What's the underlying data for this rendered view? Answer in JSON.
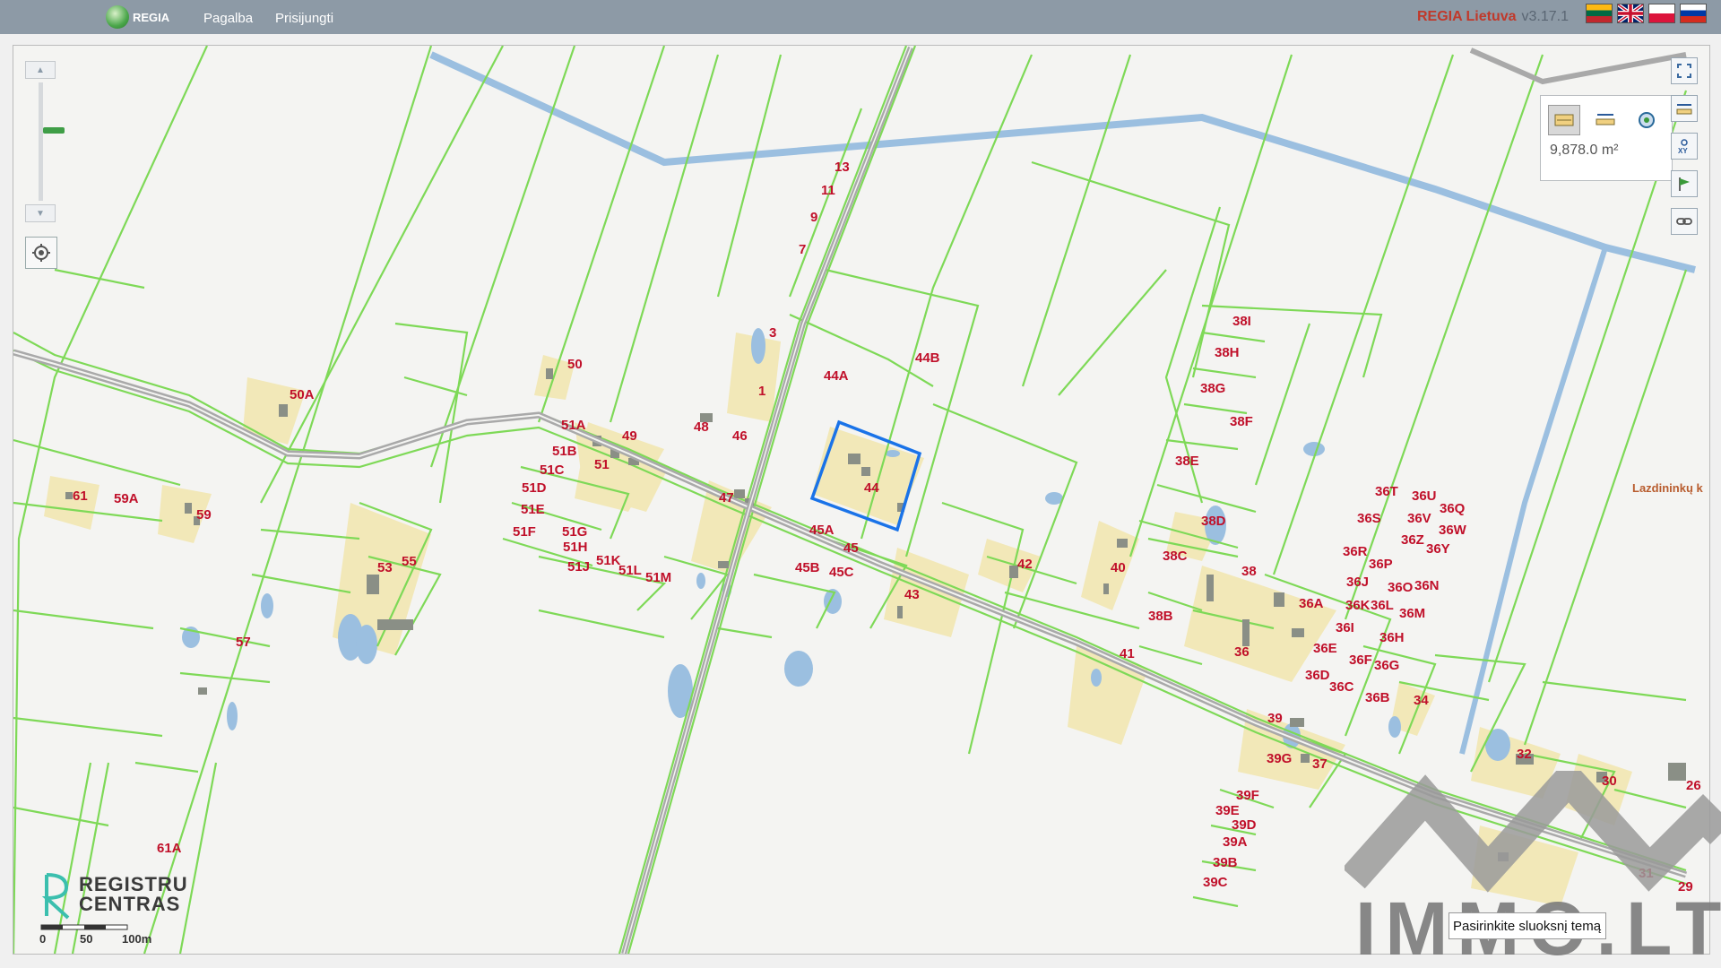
{
  "app": {
    "logo_text": "REGIA"
  },
  "nav": {
    "help": "Pagalba",
    "login": "Prisijungti"
  },
  "brand": {
    "name": "REGIA Lietuva",
    "version": "v3.17.1"
  },
  "languages": [
    "Lithuanian",
    "English",
    "Polish",
    "Russian"
  ],
  "measure": {
    "value": "9,878.0 m²"
  },
  "tools": [
    "fullscreen-icon",
    "measure-distance-icon",
    "xy-coordinates-icon",
    "flag-icon",
    "link-icon"
  ],
  "scale": {
    "labels": [
      "0",
      "50",
      "100m"
    ]
  },
  "logo": {
    "line1": "REGISTRU",
    "line2": "CENTRAS"
  },
  "search": {
    "placeholder": "Pasirinkite sluoksnį temą"
  },
  "street_label": "Lazdininkų k",
  "watermark_text": "IMMO.LT",
  "colors": {
    "parcel": "#7ed957",
    "building_lot": "#f2e8b8",
    "water": "#9bbfe0",
    "road": "#a9a9a9",
    "label": "#c0102a",
    "selected": "#1a73e8",
    "topbar": "#8d9aa6"
  },
  "parcel_labels": [
    "13",
    "11",
    "9",
    "7",
    "3",
    "1",
    "50",
    "50A",
    "51A",
    "51B",
    "51C",
    "51D",
    "51E",
    "51F",
    "51G",
    "51H",
    "51J",
    "51K",
    "51L",
    "51M",
    "51",
    "49",
    "48",
    "46",
    "47",
    "45A",
    "45",
    "45B",
    "45C",
    "44A",
    "44B",
    "44",
    "43",
    "42",
    "40",
    "41",
    "38I",
    "38H",
    "38G",
    "38F",
    "38E",
    "38D",
    "38C",
    "38",
    "38B",
    "36A",
    "36T",
    "36U",
    "36S",
    "36V",
    "36Q",
    "36W",
    "36Z",
    "36Y",
    "36R",
    "36P",
    "36J",
    "36O",
    "36N",
    "36K",
    "36L",
    "36M",
    "36I",
    "36H",
    "36E",
    "36F",
    "36G",
    "36D",
    "36C",
    "36B",
    "36",
    "34",
    "39",
    "39G",
    "37",
    "39F",
    "39E",
    "39D",
    "39A",
    "39B",
    "39C",
    "32",
    "30",
    "31",
    "29",
    "26",
    "61",
    "59A",
    "59",
    "53",
    "55",
    "57",
    "61A"
  ]
}
